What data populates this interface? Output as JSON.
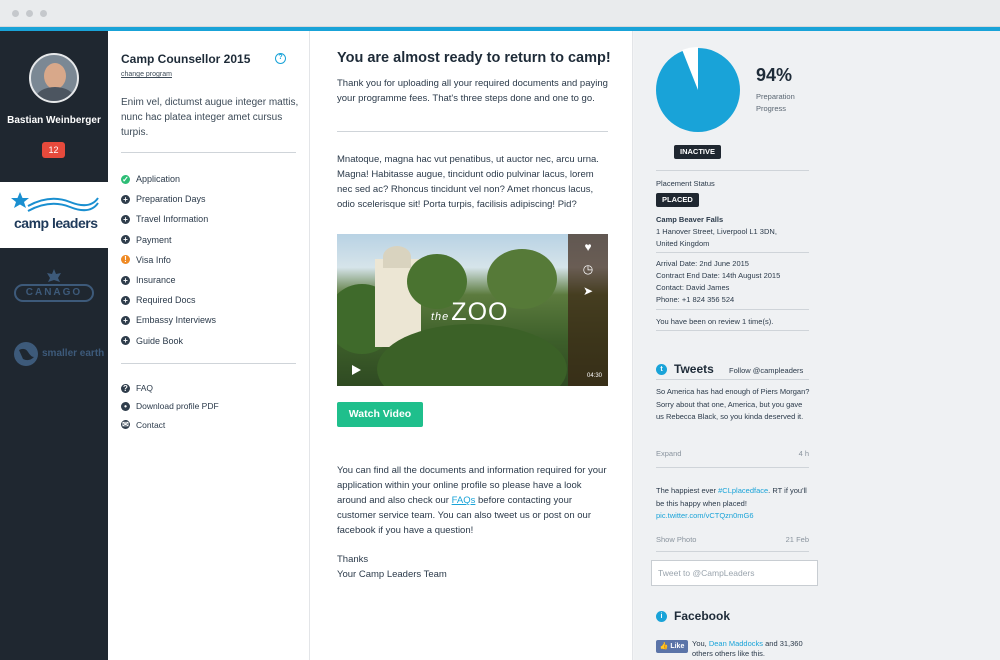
{
  "sidebar": {
    "user_name": "Bastian Weinberger",
    "notifications": "12",
    "brands": [
      {
        "label": "camp leaders"
      },
      {
        "label": "CANAGO"
      },
      {
        "label": "smaller earth"
      }
    ]
  },
  "program": {
    "title": "Camp Counsellor 2015",
    "help_icon": "?",
    "change_link": "change program",
    "intro": "Enim vel, dictumst augue integer mattis, nunc hac platea integer amet cursus turpis.",
    "steps": [
      {
        "label": "Application",
        "status": "done"
      },
      {
        "label": "Preparation Days",
        "status": "todo"
      },
      {
        "label": "Travel Information",
        "status": "todo"
      },
      {
        "label": "Payment",
        "status": "todo"
      },
      {
        "label": "Visa Info",
        "status": "warn"
      },
      {
        "label": "Insurance",
        "status": "todo"
      },
      {
        "label": "Required Docs",
        "status": "todo"
      },
      {
        "label": "Embassy Interviews",
        "status": "todo"
      },
      {
        "label": "Guide Book",
        "status": "todo"
      }
    ],
    "links": [
      {
        "label": "FAQ",
        "icon": "question-icon"
      },
      {
        "label": "Download profile PDF",
        "icon": "user-icon"
      },
      {
        "label": "Contact",
        "icon": "mail-icon"
      }
    ]
  },
  "main": {
    "heading": "You are almost ready to return to camp!",
    "para1": "Thank you for uploading all your required documents and paying your programme fees. That's three steps done and one to go.",
    "para2": "Mnatoque, magna hac vut penatibus, ut auctor nec, arcu urna. Magna! Habitasse augue, tincidunt odio pulvinar lacus, lorem nec sed ac? Rhoncus tincidunt vel non? Amet rhoncus lacus, odio scelerisque sit! Porta turpis, facilisis adipiscing! Pid?",
    "video": {
      "title_small": "the",
      "title": "ZOO",
      "duration": "04:30"
    },
    "watch_button": "Watch Video",
    "para3_before": "You can find all the documents and information required for your application within your online profile so please have a look around and also check our ",
    "para3_link": "FAQs",
    "para3_after": " before contacting your customer service team. You can also tweet us or post on our facebook if you have a question!",
    "sign_thanks": "Thanks",
    "sign_team": "Your Camp Leaders Team"
  },
  "progress": {
    "percent": "94%",
    "value": 0.94,
    "label_line1": "Preparation",
    "label_line2": "Progress",
    "status_badge": "INACTIVE",
    "color": "#19a3d8"
  },
  "placement": {
    "status_label": "Placement Status",
    "status_badge": "PLACED",
    "camp_name": "Camp Beaver Falls",
    "address1": "1 Hanover Street, Liverpool L1 3DN,",
    "address2": "United Kingdom",
    "arrival": "Arrival Date: 2nd June 2015",
    "contract_end": "Contract End Date: 14th August 2015",
    "contact": "Contact: David James",
    "phone": "Phone: +1 824 356 524",
    "review": "You have been on review 1 time(s)."
  },
  "twitter": {
    "title": "Tweets",
    "follow": "Follow @campleaders",
    "tweet1": "So America has had enough of Piers Morgan? Sorry about that one, America, but you gave us Rebecca Black, so you kinda deserved it.",
    "tweet1_action": "Expand",
    "tweet1_time": "4 h",
    "tweet2_before": "The happiest ever ",
    "tweet2_hashtag": "#CLplacedface",
    "tweet2_after": ". RT if you'll be this happy when placed!",
    "tweet2_link": "pic.twitter.com/vCTQzn0mG6",
    "tweet2_action": "Show Photo",
    "tweet2_time": "21 Feb",
    "input_placeholder": "Tweet to @CampLeaders"
  },
  "facebook": {
    "title": "Facebook",
    "like_button": "Like",
    "likes_text_before": "You, ",
    "likes_name": "Dean Maddocks",
    "likes_text_after": " and 31,360 others others like this."
  }
}
